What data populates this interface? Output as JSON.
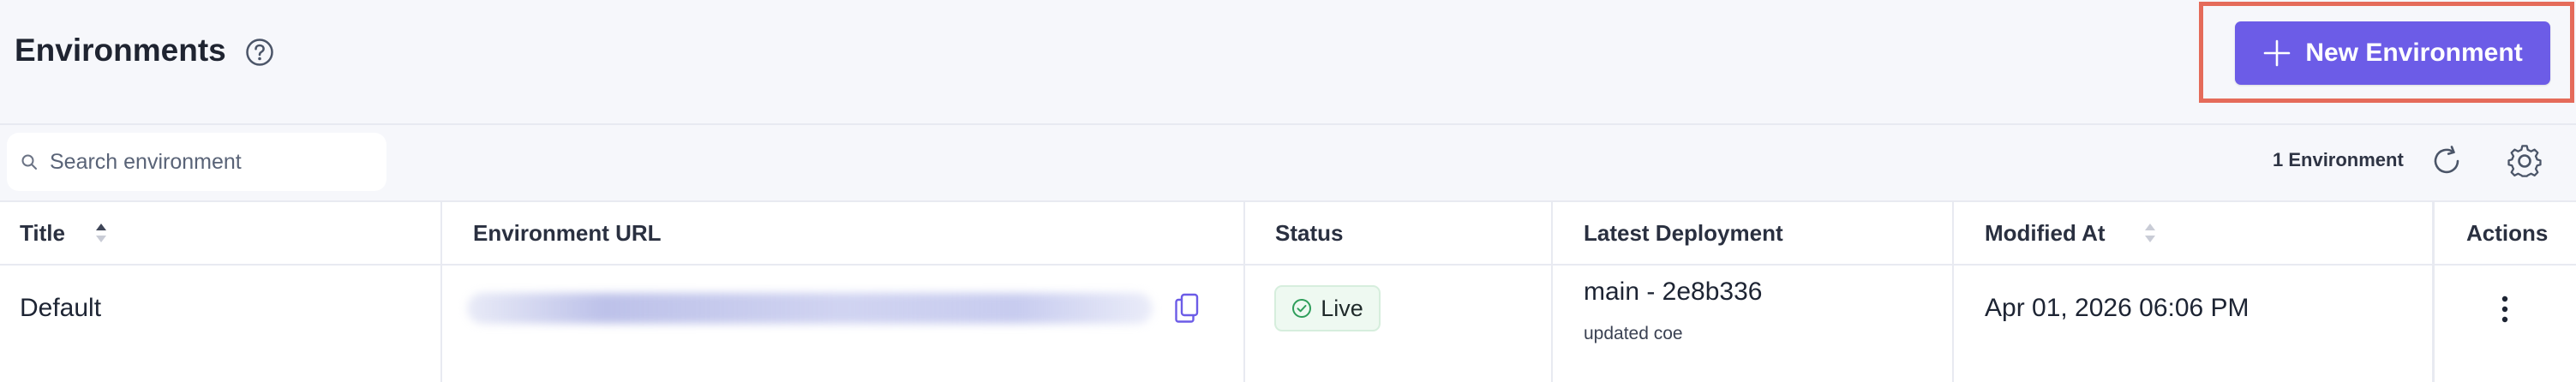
{
  "header": {
    "title": "Environments",
    "new_button_label": "New Environment"
  },
  "toolbar": {
    "search_placeholder": "Search environment",
    "search_value": "",
    "count_label": "1 Environment"
  },
  "table": {
    "columns": [
      "Title",
      "Environment URL",
      "Status",
      "Latest Deployment",
      "Modified At",
      "Actions"
    ],
    "rows": [
      {
        "title": "Default",
        "status": "Live",
        "deployment_commit": "main - 2e8b336",
        "deployment_message": "updated coe",
        "modified_at": "Apr 01, 2026 06:06 PM"
      }
    ]
  },
  "icons": {
    "help": "help-circle-icon",
    "plus": "plus-icon",
    "search": "search-icon",
    "refresh": "refresh-icon",
    "settings": "gear-icon",
    "copy": "copy-icon",
    "status": "check-circle-icon",
    "actions": "kebab-menu-icon"
  },
  "colors": {
    "accent": "#6c5ce7",
    "highlight": "#e56b5a",
    "live_green": "#2f9e5b"
  }
}
